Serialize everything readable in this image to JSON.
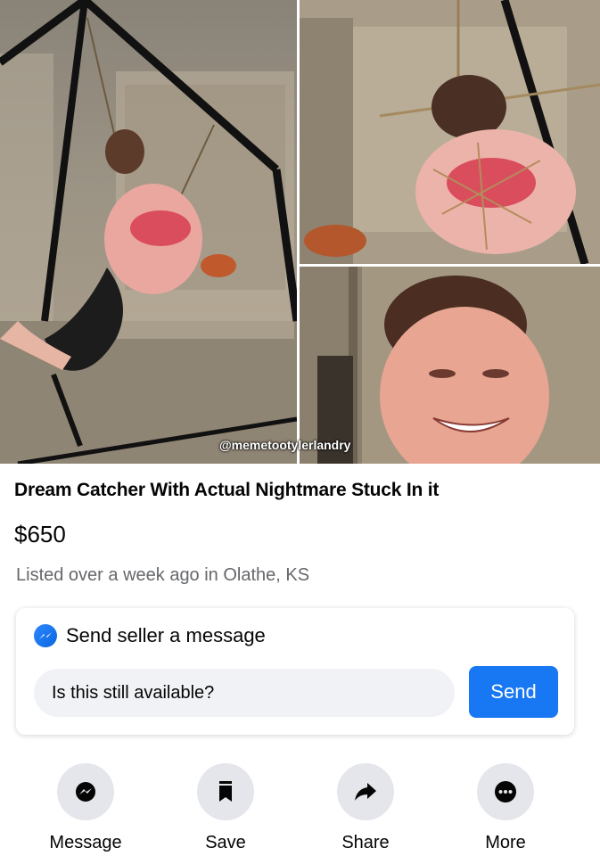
{
  "photos": {
    "watermark": "@memetootylerlandry"
  },
  "listing": {
    "title": "Dream Catcher With Actual Nightmare Stuck In it",
    "price": "$650",
    "meta": "Listed over a week ago in Olathe, KS"
  },
  "message_card": {
    "heading": "Send seller a message",
    "input_value": "Is this still available?",
    "send_label": "Send",
    "icon": "messenger-icon"
  },
  "actions": [
    {
      "label": "Message",
      "icon": "messenger-icon"
    },
    {
      "label": "Save",
      "icon": "bookmark-icon"
    },
    {
      "label": "Share",
      "icon": "share-arrow-icon"
    },
    {
      "label": "More",
      "icon": "more-dots-icon"
    }
  ],
  "colors": {
    "accent": "#1877f2",
    "muted_text": "#65676b",
    "button_bg": "#e4e6eb",
    "input_bg": "#f0f2f5"
  }
}
